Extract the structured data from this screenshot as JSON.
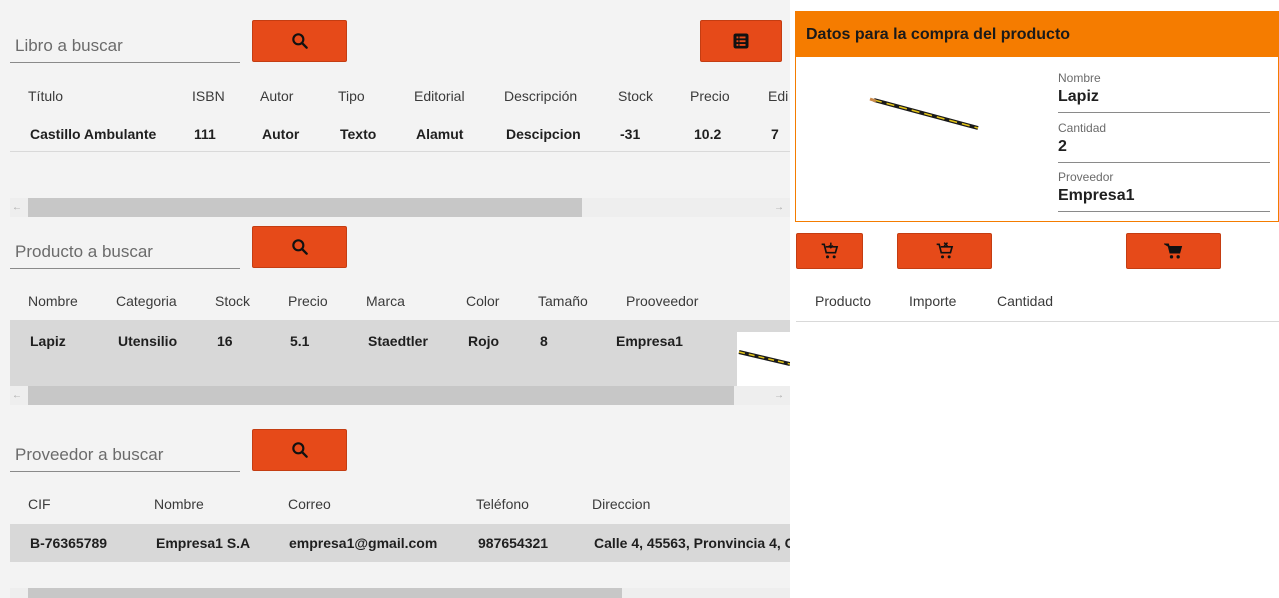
{
  "libro": {
    "search_placeholder": "Libro a buscar",
    "columns": [
      "Título",
      "ISBN",
      "Autor",
      "Tipo",
      "Editorial",
      "Descripción",
      "Stock",
      "Precio",
      "Edi"
    ],
    "rows": [
      [
        "Castillo Ambulante",
        "111",
        "Autor",
        "Texto",
        "Alamut",
        "Descipcion",
        "-31",
        "10.2",
        "7"
      ]
    ]
  },
  "producto": {
    "search_placeholder": "Producto a buscar",
    "columns": [
      "Nombre",
      "Categoria",
      "Stock",
      "Precio",
      "Marca",
      "Color",
      "Tamaño",
      "Prooveedor"
    ],
    "rows": [
      [
        "Lapiz",
        "Utensilio",
        "16",
        "5.1",
        "Staedtler",
        "Rojo",
        "8",
        "Empresa1"
      ]
    ]
  },
  "proveedor": {
    "search_placeholder": "Proveedor a buscar",
    "columns": [
      "CIF",
      "Nombre",
      "Correo",
      "Teléfono",
      "Direccion"
    ],
    "rows": [
      [
        "B-76365789",
        "Empresa1 S.A",
        "empresa1@gmail.com",
        "987654321",
        "Calle 4, 45563, Pronvincia 4, C"
      ]
    ]
  },
  "compra": {
    "title": "Datos para la compra del producto",
    "nombre_label": "Nombre",
    "nombre_value": "Lapiz",
    "cantidad_label": "Cantidad",
    "cantidad_value": "2",
    "proveedor_label": "Proveedor",
    "proveedor_value": "Empresa1"
  },
  "carrito": {
    "columns": [
      "Producto",
      "Importe",
      "Cantidad"
    ]
  },
  "icons": {
    "search": "search-icon",
    "list": "list-icon",
    "add_cart": "add-to-cart-icon",
    "remove_cart": "remove-from-cart-icon",
    "cart": "shopping-cart-icon"
  },
  "colors": {
    "accent_button": "#e64a19",
    "card_header": "#f57c00"
  }
}
